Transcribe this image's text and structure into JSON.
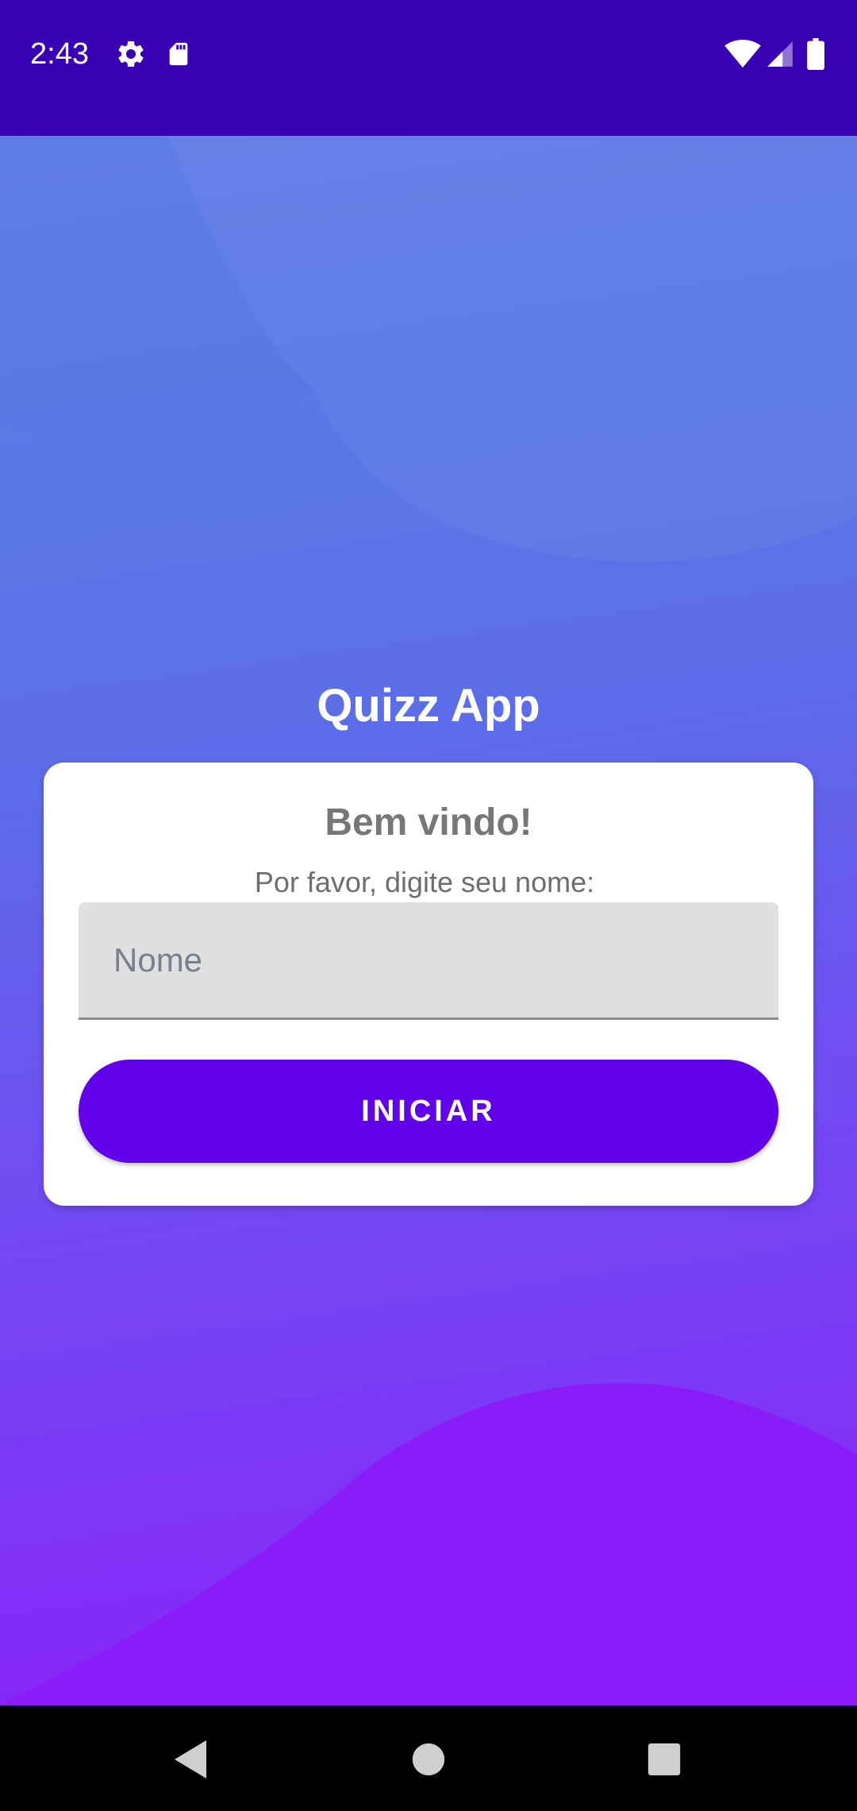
{
  "status_bar": {
    "time": "2:43",
    "icons": [
      "gear-icon",
      "sd-card-icon",
      "wifi-icon",
      "cell-signal-icon",
      "battery-icon"
    ]
  },
  "app": {
    "title": "Quizz App"
  },
  "card": {
    "title": "Bem vindo!",
    "subtitle": "Por favor, digite seu nome:",
    "name_input": {
      "value": "",
      "placeholder": "Nome"
    },
    "start_button_label": "INICIAR"
  },
  "nav_bar": {
    "buttons": [
      "back-icon",
      "home-icon",
      "recents-icon"
    ]
  },
  "colors": {
    "status_bar": "#3700b3",
    "primary_button": "#6200ea",
    "card_background": "#ffffff",
    "gradient_top": "#6a84e8",
    "gradient_bottom": "#8a1ff8"
  }
}
